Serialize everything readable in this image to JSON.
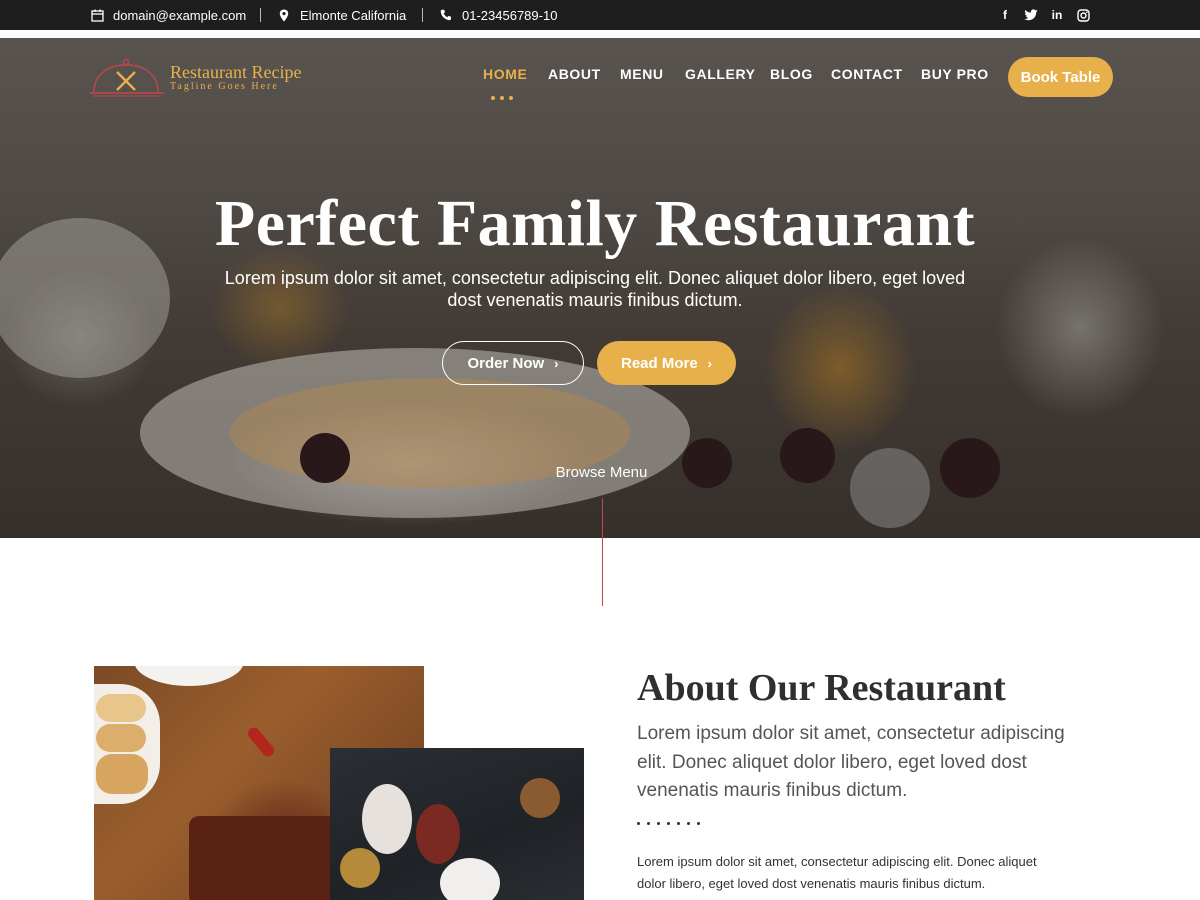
{
  "topbar": {
    "email": "domain@example.com",
    "location": "Elmonte California",
    "phone": "01-23456789-10",
    "social_icons": [
      "facebook-icon",
      "twitter-icon",
      "linkedin-icon",
      "instagram-icon"
    ]
  },
  "brand": {
    "name": "Restaurant Recipe",
    "tagline": "Tagline Goes Here",
    "accent_color": "#e8b04a"
  },
  "nav": {
    "items": [
      "HOME",
      "ABOUT",
      "MENU",
      "GALLERY",
      "BLOG",
      "CONTACT",
      "BUY PRO"
    ],
    "active": "HOME",
    "book_label": "Book Table"
  },
  "hero": {
    "title": "Perfect Family Restaurant",
    "subtitle": "Lorem ipsum dolor sit amet, consectetur adipiscing elit. Donec aliquet dolor libero, eget loved dost venenatis mauris finibus dictum.",
    "order_label": "Order Now",
    "read_label": "Read More",
    "browse_label": "Browse Menu"
  },
  "about": {
    "title": "About Our Restaurant",
    "lead": "Lorem ipsum dolor sit amet, consectetur adipiscing elit. Donec aliquet dolor libero, eget loved dost venenatis mauris finibus dictum.",
    "body": "Lorem ipsum dolor sit amet, consectetur adipiscing elit. Donec aliquet dolor libero, eget loved dost venenatis mauris finibus dictum."
  }
}
